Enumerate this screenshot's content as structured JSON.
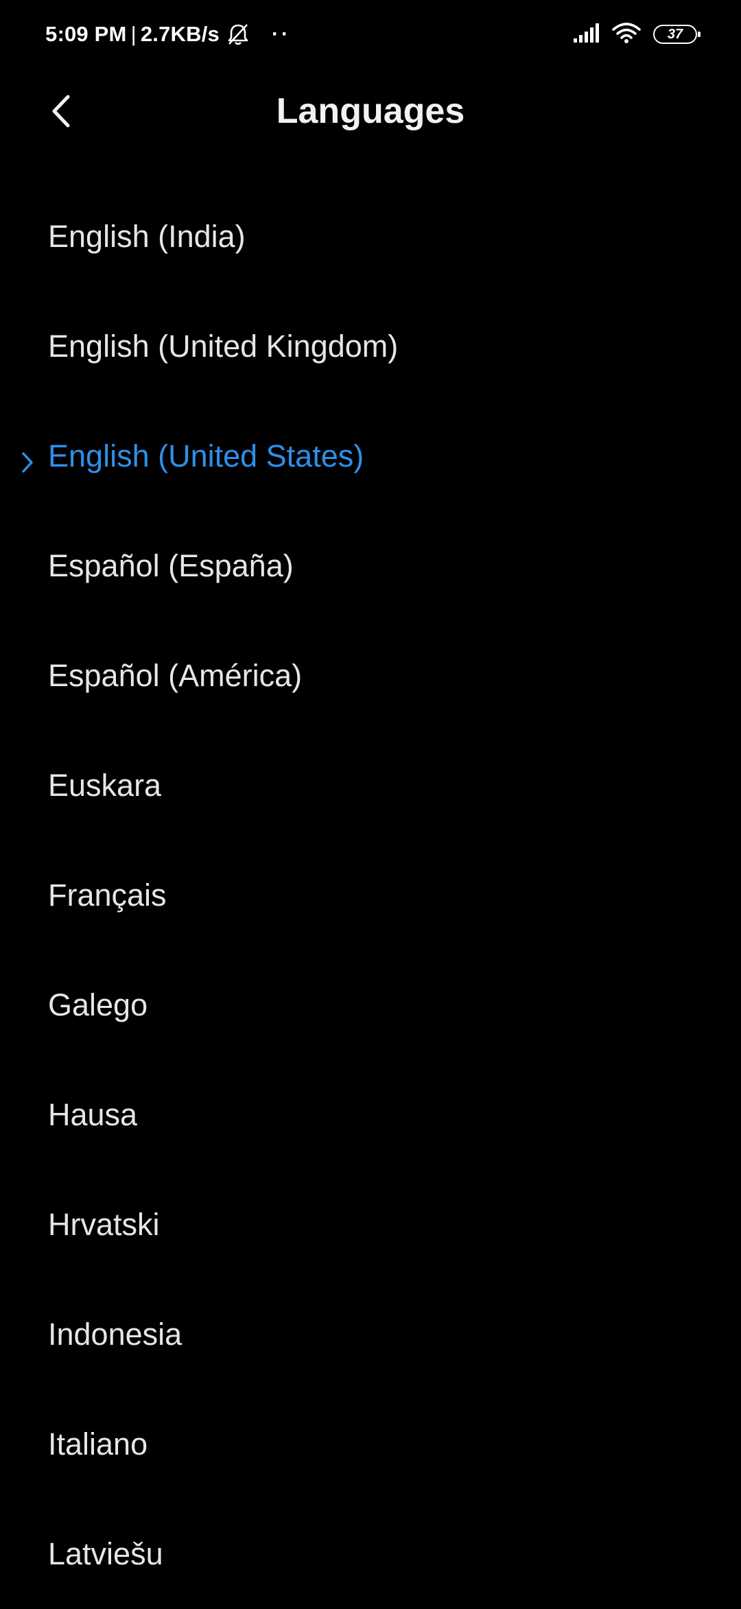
{
  "status_bar": {
    "time": "5:09 PM",
    "separator": "|",
    "speed": "2.7KB/s",
    "dots": "··",
    "battery": "37",
    "icons": [
      "muted-bell-icon",
      "signal-icon",
      "wifi-icon",
      "battery-icon"
    ]
  },
  "header": {
    "title": "Languages",
    "back_icon": "chevron-left-icon"
  },
  "languages": [
    {
      "label": "English (India)",
      "selected": false
    },
    {
      "label": "English (United Kingdom)",
      "selected": false
    },
    {
      "label": "English (United States)",
      "selected": true
    },
    {
      "label": "Español (España)",
      "selected": false
    },
    {
      "label": "Español (América)",
      "selected": false
    },
    {
      "label": "Euskara",
      "selected": false
    },
    {
      "label": "Français",
      "selected": false
    },
    {
      "label": "Galego",
      "selected": false
    },
    {
      "label": "Hausa",
      "selected": false
    },
    {
      "label": "Hrvatski",
      "selected": false
    },
    {
      "label": "Indonesia",
      "selected": false
    },
    {
      "label": "Italiano",
      "selected": false
    },
    {
      "label": "Latviešu",
      "selected": false
    }
  ],
  "colors": {
    "background": "#000000",
    "text": "#e6e6e6",
    "accent": "#2e8fe8"
  }
}
